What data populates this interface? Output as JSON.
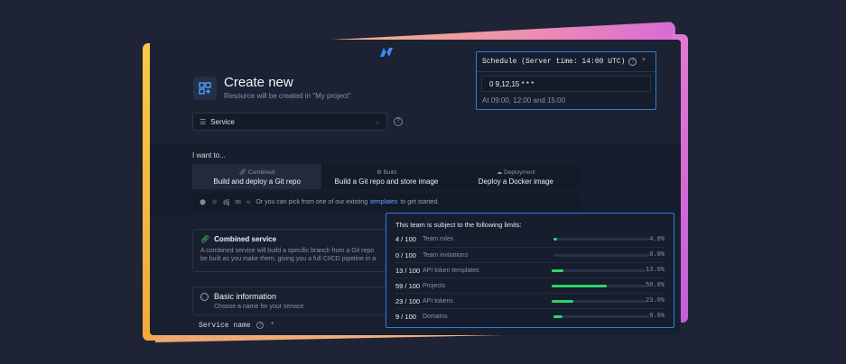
{
  "create": {
    "title": "Create new",
    "subtitle": "Resource will be created in \"My project\""
  },
  "service_select": {
    "value": "Service"
  },
  "i_want": {
    "label": "I want to...",
    "cards": [
      {
        "kicker": "Combined",
        "title": "Build and deploy a Git repo",
        "icon": "link-icon",
        "active": true
      },
      {
        "kicker": "Build",
        "title": "Build a Git repo and store image",
        "icon": "gear-icon",
        "active": false
      },
      {
        "kicker": "Deployment",
        "title": "Deploy a Docker image",
        "icon": "cloud-icon",
        "active": false
      }
    ]
  },
  "templates": {
    "framework_icons": [
      "⬢",
      "⚛",
      "dj",
      "✉",
      "≈"
    ],
    "text_before": "Or you can pick from one of our existing",
    "link": "templates",
    "text_after": "to get started."
  },
  "combined_service": {
    "title": "Combined service",
    "desc_line1": "A combined service will build a specific branch from a Git repo",
    "desc_line2": "be built as you make them, giving you a full CI/CD pipeline in a"
  },
  "basic_info": {
    "title": "Basic information",
    "subtitle": "Choose a name for your service",
    "service_name_label": "Service name"
  },
  "schedule": {
    "title": "Schedule (Server time: 14:00 UTC)",
    "cron": "0 9,12,15 * * *",
    "hint": "At 09:00, 12:00 and 15:00"
  },
  "limits": {
    "heading": "This team is subject to the following limits:",
    "rows": [
      {
        "count": "4 / 100",
        "label": "Team roles",
        "percent": "4.0%",
        "fraction": 0.04
      },
      {
        "count": "0 / 100",
        "label": "Team invitations",
        "percent": "0.0%",
        "fraction": 0.0
      },
      {
        "count": "13 / 100",
        "label": "API token templates",
        "percent": "13.0%",
        "fraction": 0.13
      },
      {
        "count": "59 / 100",
        "label": "Projects",
        "percent": "59.0%",
        "fraction": 0.59
      },
      {
        "count": "23 / 100",
        "label": "API tokens",
        "percent": "23.0%",
        "fraction": 0.23
      },
      {
        "count": "9 / 100",
        "label": "Domains",
        "percent": "9.0%",
        "fraction": 0.09
      }
    ]
  },
  "colors": {
    "accent": "#2f7fe0",
    "success": "#2fd36a",
    "link": "#5aa7ff"
  }
}
